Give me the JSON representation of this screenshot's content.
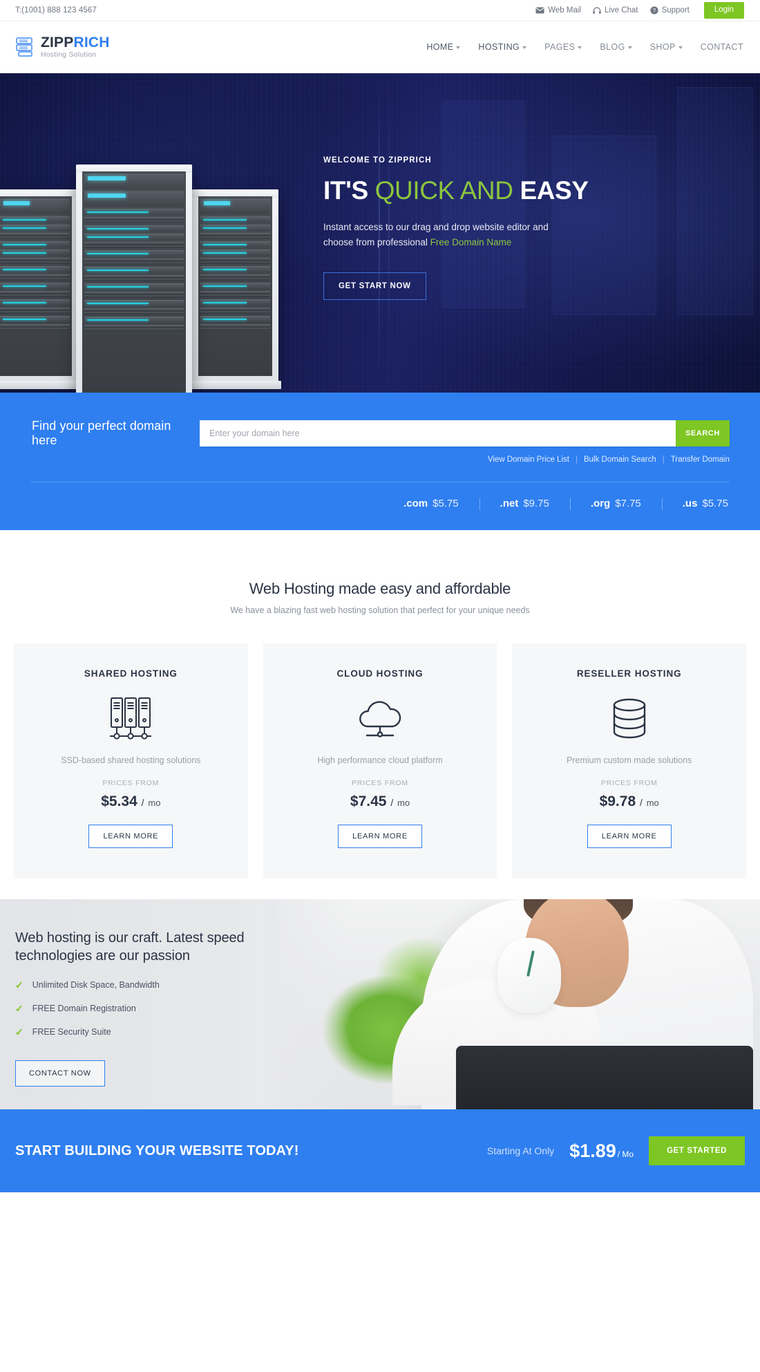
{
  "topbar": {
    "phone": "T:(1001) 888 123 4567",
    "links": [
      {
        "label": "Web Mail",
        "icon": "envelope-icon"
      },
      {
        "label": "Live Chat",
        "icon": "headset-icon"
      },
      {
        "label": "Support",
        "icon": "help-circle-icon"
      }
    ],
    "login_label": "Login",
    "login_color": "#7dc623"
  },
  "header": {
    "logo_first": "ZIPP",
    "logo_second": "RICH",
    "logo_tagline": "Hosting Solution",
    "logo_accent": "#2f7ff0",
    "nav": [
      {
        "label": "HOME",
        "has_caret": true,
        "muted": false
      },
      {
        "label": "HOSTING",
        "has_caret": true,
        "muted": false
      },
      {
        "label": "PAGES",
        "has_caret": true,
        "muted": true
      },
      {
        "label": "BLOG",
        "has_caret": true,
        "muted": true
      },
      {
        "label": "SHOP",
        "has_caret": true,
        "muted": true
      },
      {
        "label": "CONTACT",
        "has_caret": false,
        "muted": true
      }
    ]
  },
  "hero": {
    "eyebrow": "WELCOME TO ZIPPRICH",
    "title_part1": "IT'S ",
    "title_accent": "QUICK AND",
    "title_part2": " EASY",
    "desc_part1": "Instant access to our drag and drop website editor and choose from professional ",
    "desc_accent": "Free Domain Name",
    "button_label": "GET START NOW",
    "accent_color": "#8cc63e"
  },
  "domain": {
    "label": "Find your perfect domain here",
    "placeholder": "Enter your domain here",
    "search_label": "SEARCH",
    "links": [
      "View Domain Price List",
      "Bulk Domain Search",
      "Transfer Domain"
    ],
    "band_color": "#2f7ff0",
    "tlds": [
      {
        "name": ".com",
        "price": "$5.75"
      },
      {
        "name": ".net",
        "price": "$9.75"
      },
      {
        "name": ".org",
        "price": "$7.75"
      },
      {
        "name": ".us",
        "price": "$5.75"
      }
    ]
  },
  "hosting": {
    "title": "Web Hosting made easy and affordable",
    "subtitle": "We have a blazing fast web hosting solution that perfect for your unique needs",
    "price_label": "PRICES FROM",
    "cards": [
      {
        "title": "SHARED HOSTING",
        "icon": "servers-icon",
        "desc": "SSD-based shared hosting solutions",
        "price_label": "PRICES FROM",
        "price": "$5.34",
        "per": "/",
        "unit": "mo",
        "button_label": "LEARN MORE"
      },
      {
        "title": "CLOUD HOSTING",
        "icon": "cloud-icon",
        "desc": "High performance cloud platform",
        "price_label": "PRICES FROM",
        "price": "$7.45",
        "per": "/",
        "unit": "mo",
        "button_label": "LEARN MORE"
      },
      {
        "title": "RESELLER HOSTING",
        "icon": "database-icon",
        "desc": "Premium custom made solutions",
        "price_label": "PRICES FROM",
        "price": "$9.78",
        "per": "/",
        "unit": "mo",
        "button_label": "LEARN MORE"
      }
    ]
  },
  "craft": {
    "title": "Web hosting is our craft. Latest speed technologies are our passion",
    "features": [
      "Unlimited Disk Space, Bandwidth",
      "FREE Domain Registration",
      "FREE Security Suite"
    ],
    "button_label": "CONTACT NOW",
    "tick_color": "#7dc623"
  },
  "cta": {
    "title": "START BUILDING YOUR WEBSITE TODAY!",
    "starting_label": "Starting At Only",
    "price": "$1.89",
    "unit": "/ Mo",
    "button_label": "GET STARTED",
    "band_color": "#2f7ff0",
    "button_color": "#7dc623"
  }
}
